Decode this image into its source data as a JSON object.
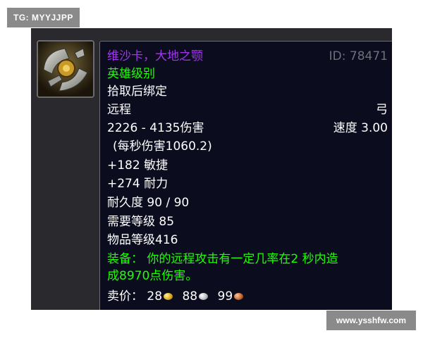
{
  "watermarks": {
    "top_left": "TG: MYYJJPP",
    "bottom_right": "www.ysshfw.com"
  },
  "item": {
    "icon": "axe-weapon-icon",
    "name": "维沙卡，大地之颚",
    "id": "ID: 78471",
    "quality": "英雄级别",
    "binding": "拾取后绑定",
    "slot": "远程",
    "type": "弓",
    "damage": "2226 - 4135伤害",
    "speed": "速度 3.00",
    "dps": "(每秒伤害1060.2)",
    "agility": "+182 敏捷",
    "stamina": "+274 耐力",
    "durability": "耐久度 90 / 90",
    "required_level": "需要等级 85",
    "item_level": "物品等级416",
    "equip_line1": "装备：  你的远程攻击有一定几率在2 秒内造",
    "equip_line2": "成8970点伤害。",
    "sell_label": "卖价：",
    "sell_gold": "28",
    "sell_silver": "88",
    "sell_copper": "99"
  },
  "colors": {
    "name": "#a335ee",
    "quality": "#1eff00",
    "equip": "#1eff00",
    "id": "#6f6f78",
    "tooltip_bg": "#0b0d1f"
  }
}
